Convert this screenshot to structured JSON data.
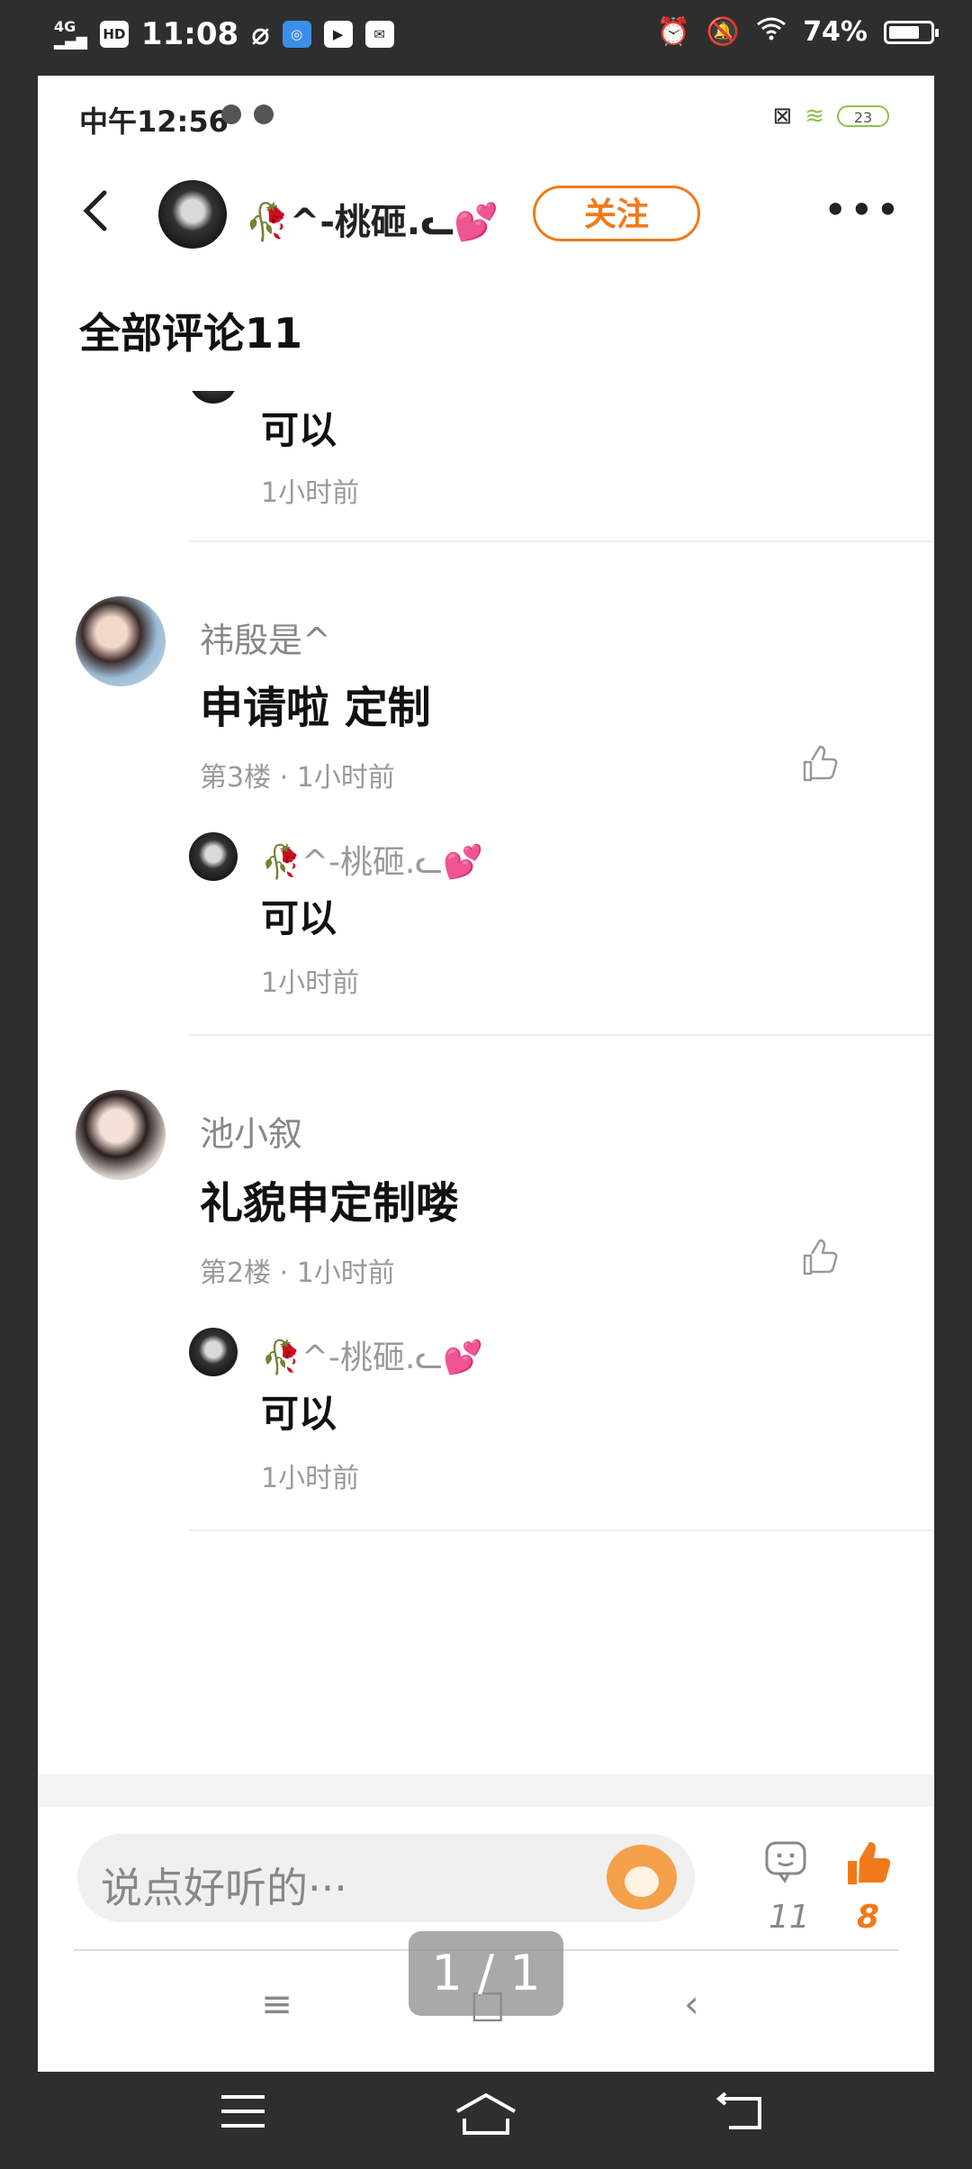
{
  "system_status": {
    "network": "4G",
    "hd": "HD",
    "time": "11:08",
    "battery_percent": "74%",
    "battery_level": 0.74
  },
  "screenshot_status": {
    "time": "中午12:56",
    "battery": "23"
  },
  "header": {
    "author_name": "🥀^-桃砸.ᓚ💕",
    "follow_label": "关注",
    "more_label": "•••"
  },
  "section_title": "全部评论11",
  "comments": [
    {
      "partial_reply": {
        "text": "可以",
        "time": "1小时前"
      }
    },
    {
      "username": "祎殷是^",
      "text": "申请啦 定制",
      "meta": "第3楼 · 1小时前",
      "reply": {
        "name": "🥀^-桃砸.ᓚ💕",
        "text": "可以",
        "time": "1小时前"
      }
    },
    {
      "username": "池小叙",
      "text": "礼貌申定制喽",
      "meta": "第2楼 · 1小时前",
      "reply": {
        "name": "🥀^-桃砸.ᓚ💕",
        "text": "可以",
        "time": "1小时前"
      }
    }
  ],
  "input_bar": {
    "placeholder": "说点好听的···",
    "comment_count": "11",
    "like_count": "8"
  },
  "page_indicator": "1 / 1",
  "colors": {
    "accent": "#f07a1a",
    "background": "#2e2e2e"
  }
}
